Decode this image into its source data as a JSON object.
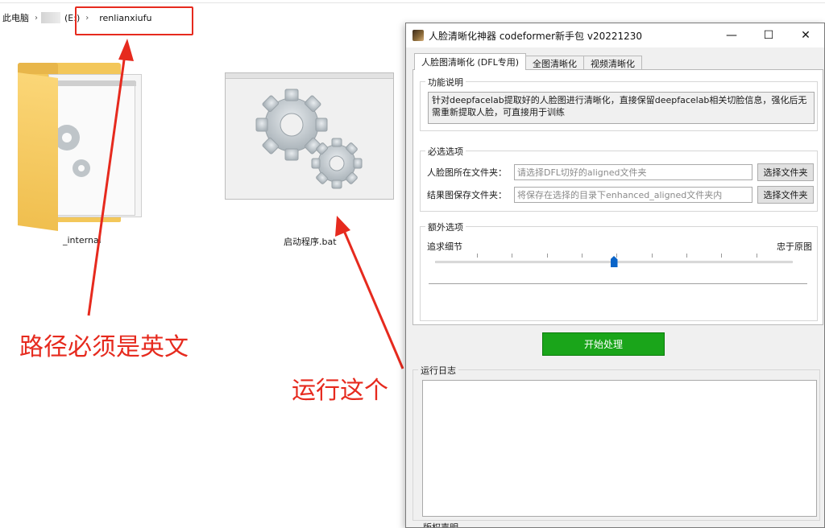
{
  "explorer": {
    "breadcrumb": [
      "此电脑",
      "(E:)",
      "renlianxiufu"
    ],
    "files": [
      {
        "name": "_internal",
        "type": "folder"
      },
      {
        "name": "启动程序.bat",
        "type": "bat"
      }
    ]
  },
  "annotations": {
    "path_note": "路径必须是英文",
    "run_note": "运行这个",
    "color": "#e62a1e"
  },
  "dialog": {
    "title": "人脸清晰化神器 codeformer新手包 v20221230",
    "controls": {
      "minimize": "—",
      "maximize": "☐",
      "close": "✕"
    },
    "tabs": [
      {
        "label": "人脸图清晰化 (DFL专用)",
        "active": true
      },
      {
        "label": "全图清晰化",
        "active": false
      },
      {
        "label": "视频清晰化",
        "active": false
      }
    ],
    "function": {
      "title": "功能说明",
      "text": "针对deepfacelab提取好的人脸图进行清晰化，直接保留deepfacelab相关切脸信息，强化后无需重新提取人脸，可直接用于训练"
    },
    "required": {
      "title": "必选选项",
      "input_dir_label": "人脸图所在文件夹：",
      "input_dir_placeholder": "请选择DFL切好的aligned文件夹",
      "output_dir_label": "结果图保存文件夹：",
      "output_dir_placeholder": "将保存在选择的目录下enhanced_aligned文件夹内",
      "browse_label": "选择文件夹"
    },
    "extra": {
      "title": "额外选项",
      "left_label": "追求细节",
      "right_label": "忠于原图",
      "slider_value": 0.5
    },
    "start_label": "开始处理",
    "log_title": "运行日志",
    "copyright_title": "版权声明",
    "start_color": "#1aa51a"
  }
}
